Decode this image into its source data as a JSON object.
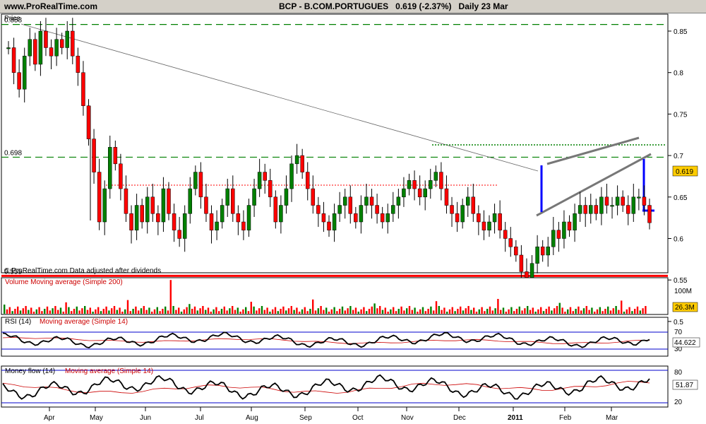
{
  "header": {
    "site": "www.ProRealTime.com",
    "symbol": "BCP - B.COM.PORTUGUES",
    "price_change": "0.619 (-2.37%)",
    "period": "Daily",
    "date": "23 Mar"
  },
  "chart_data": [
    {
      "type": "candlestick",
      "panel": "price",
      "ylabel": "Price",
      "ylim": [
        0.49,
        0.87
      ],
      "yticks": [
        0.5,
        0.55,
        0.6,
        0.65,
        0.7,
        0.75,
        0.8,
        0.85
      ],
      "ytick_labels": [
        "0.5",
        "0.55",
        "0.6",
        "0.65",
        "0.7",
        "0.75",
        "0.8",
        "0.85"
      ],
      "last_value": "0.619",
      "x_months": [
        "Apr",
        "May",
        "Jun",
        "Jul",
        "Aug",
        "Sep",
        "Oct",
        "Nov",
        "Dec",
        "2011",
        "Feb",
        "Mar"
      ],
      "annotation": "© ProRealTime.com Data adjusted after dividends",
      "levels": [
        {
          "label": "0.858",
          "value": 0.858,
          "style": "dashed",
          "color": "#008000"
        },
        {
          "label": "0.698",
          "value": 0.698,
          "style": "dashed",
          "color": "#008000"
        },
        {
          "label": "0.555",
          "value": 0.555,
          "style": "solid",
          "color": "#ff0000"
        }
      ],
      "series_close": [
        0.83,
        0.8,
        0.78,
        0.82,
        0.84,
        0.81,
        0.85,
        0.83,
        0.82,
        0.84,
        0.83,
        0.85,
        0.82,
        0.8,
        0.76,
        0.72,
        0.68,
        0.62,
        0.66,
        0.71,
        0.69,
        0.66,
        0.63,
        0.61,
        0.64,
        0.62,
        0.65,
        0.63,
        0.62,
        0.66,
        0.63,
        0.61,
        0.6,
        0.63,
        0.66,
        0.68,
        0.65,
        0.63,
        0.61,
        0.62,
        0.64,
        0.66,
        0.63,
        0.62,
        0.61,
        0.64,
        0.66,
        0.68,
        0.67,
        0.65,
        0.62,
        0.64,
        0.66,
        0.69,
        0.7,
        0.68,
        0.66,
        0.64,
        0.63,
        0.62,
        0.61,
        0.63,
        0.64,
        0.65,
        0.63,
        0.62,
        0.64,
        0.65,
        0.64,
        0.63,
        0.62,
        0.63,
        0.64,
        0.65,
        0.66,
        0.67,
        0.66,
        0.65,
        0.66,
        0.67,
        0.68,
        0.66,
        0.64,
        0.63,
        0.62,
        0.64,
        0.65,
        0.63,
        0.62,
        0.61,
        0.62,
        0.63,
        0.61,
        0.6,
        0.59,
        0.58,
        0.56,
        0.53,
        0.57,
        0.59,
        0.58,
        0.59,
        0.61,
        0.6,
        0.62,
        0.61,
        0.63,
        0.64,
        0.63,
        0.64,
        0.63,
        0.65,
        0.64,
        0.64,
        0.65,
        0.64,
        0.63,
        0.65,
        0.65,
        0.64,
        0.619
      ]
    },
    {
      "type": "bar",
      "panel": "volume",
      "title": "Volume Moving average (Simple 200)",
      "ytick_labels": [
        "100M"
      ],
      "last_value": "26.3M"
    },
    {
      "type": "line",
      "panel": "rsi",
      "title": "RSI (14)",
      "subtitle": "Moving average (Simple 14)",
      "ylim": [
        20,
        80
      ],
      "ytick_labels": [
        "70",
        "30"
      ],
      "last_value": "44.622"
    },
    {
      "type": "line",
      "panel": "money-flow",
      "title": "Money flow (14)",
      "subtitle": "Moving average (Simple 14)",
      "ylim": [
        10,
        90
      ],
      "ytick_labels": [
        "80",
        "20"
      ],
      "last_value": "51.87"
    }
  ],
  "colors": {
    "up": "#008000",
    "down": "#ff0000",
    "level_green": "#008000",
    "support_red": "#ff0000",
    "target_blue": "#0000ff",
    "rsi_line": "#000000",
    "ma_line": "#cc0000",
    "band": "#0000cc"
  }
}
